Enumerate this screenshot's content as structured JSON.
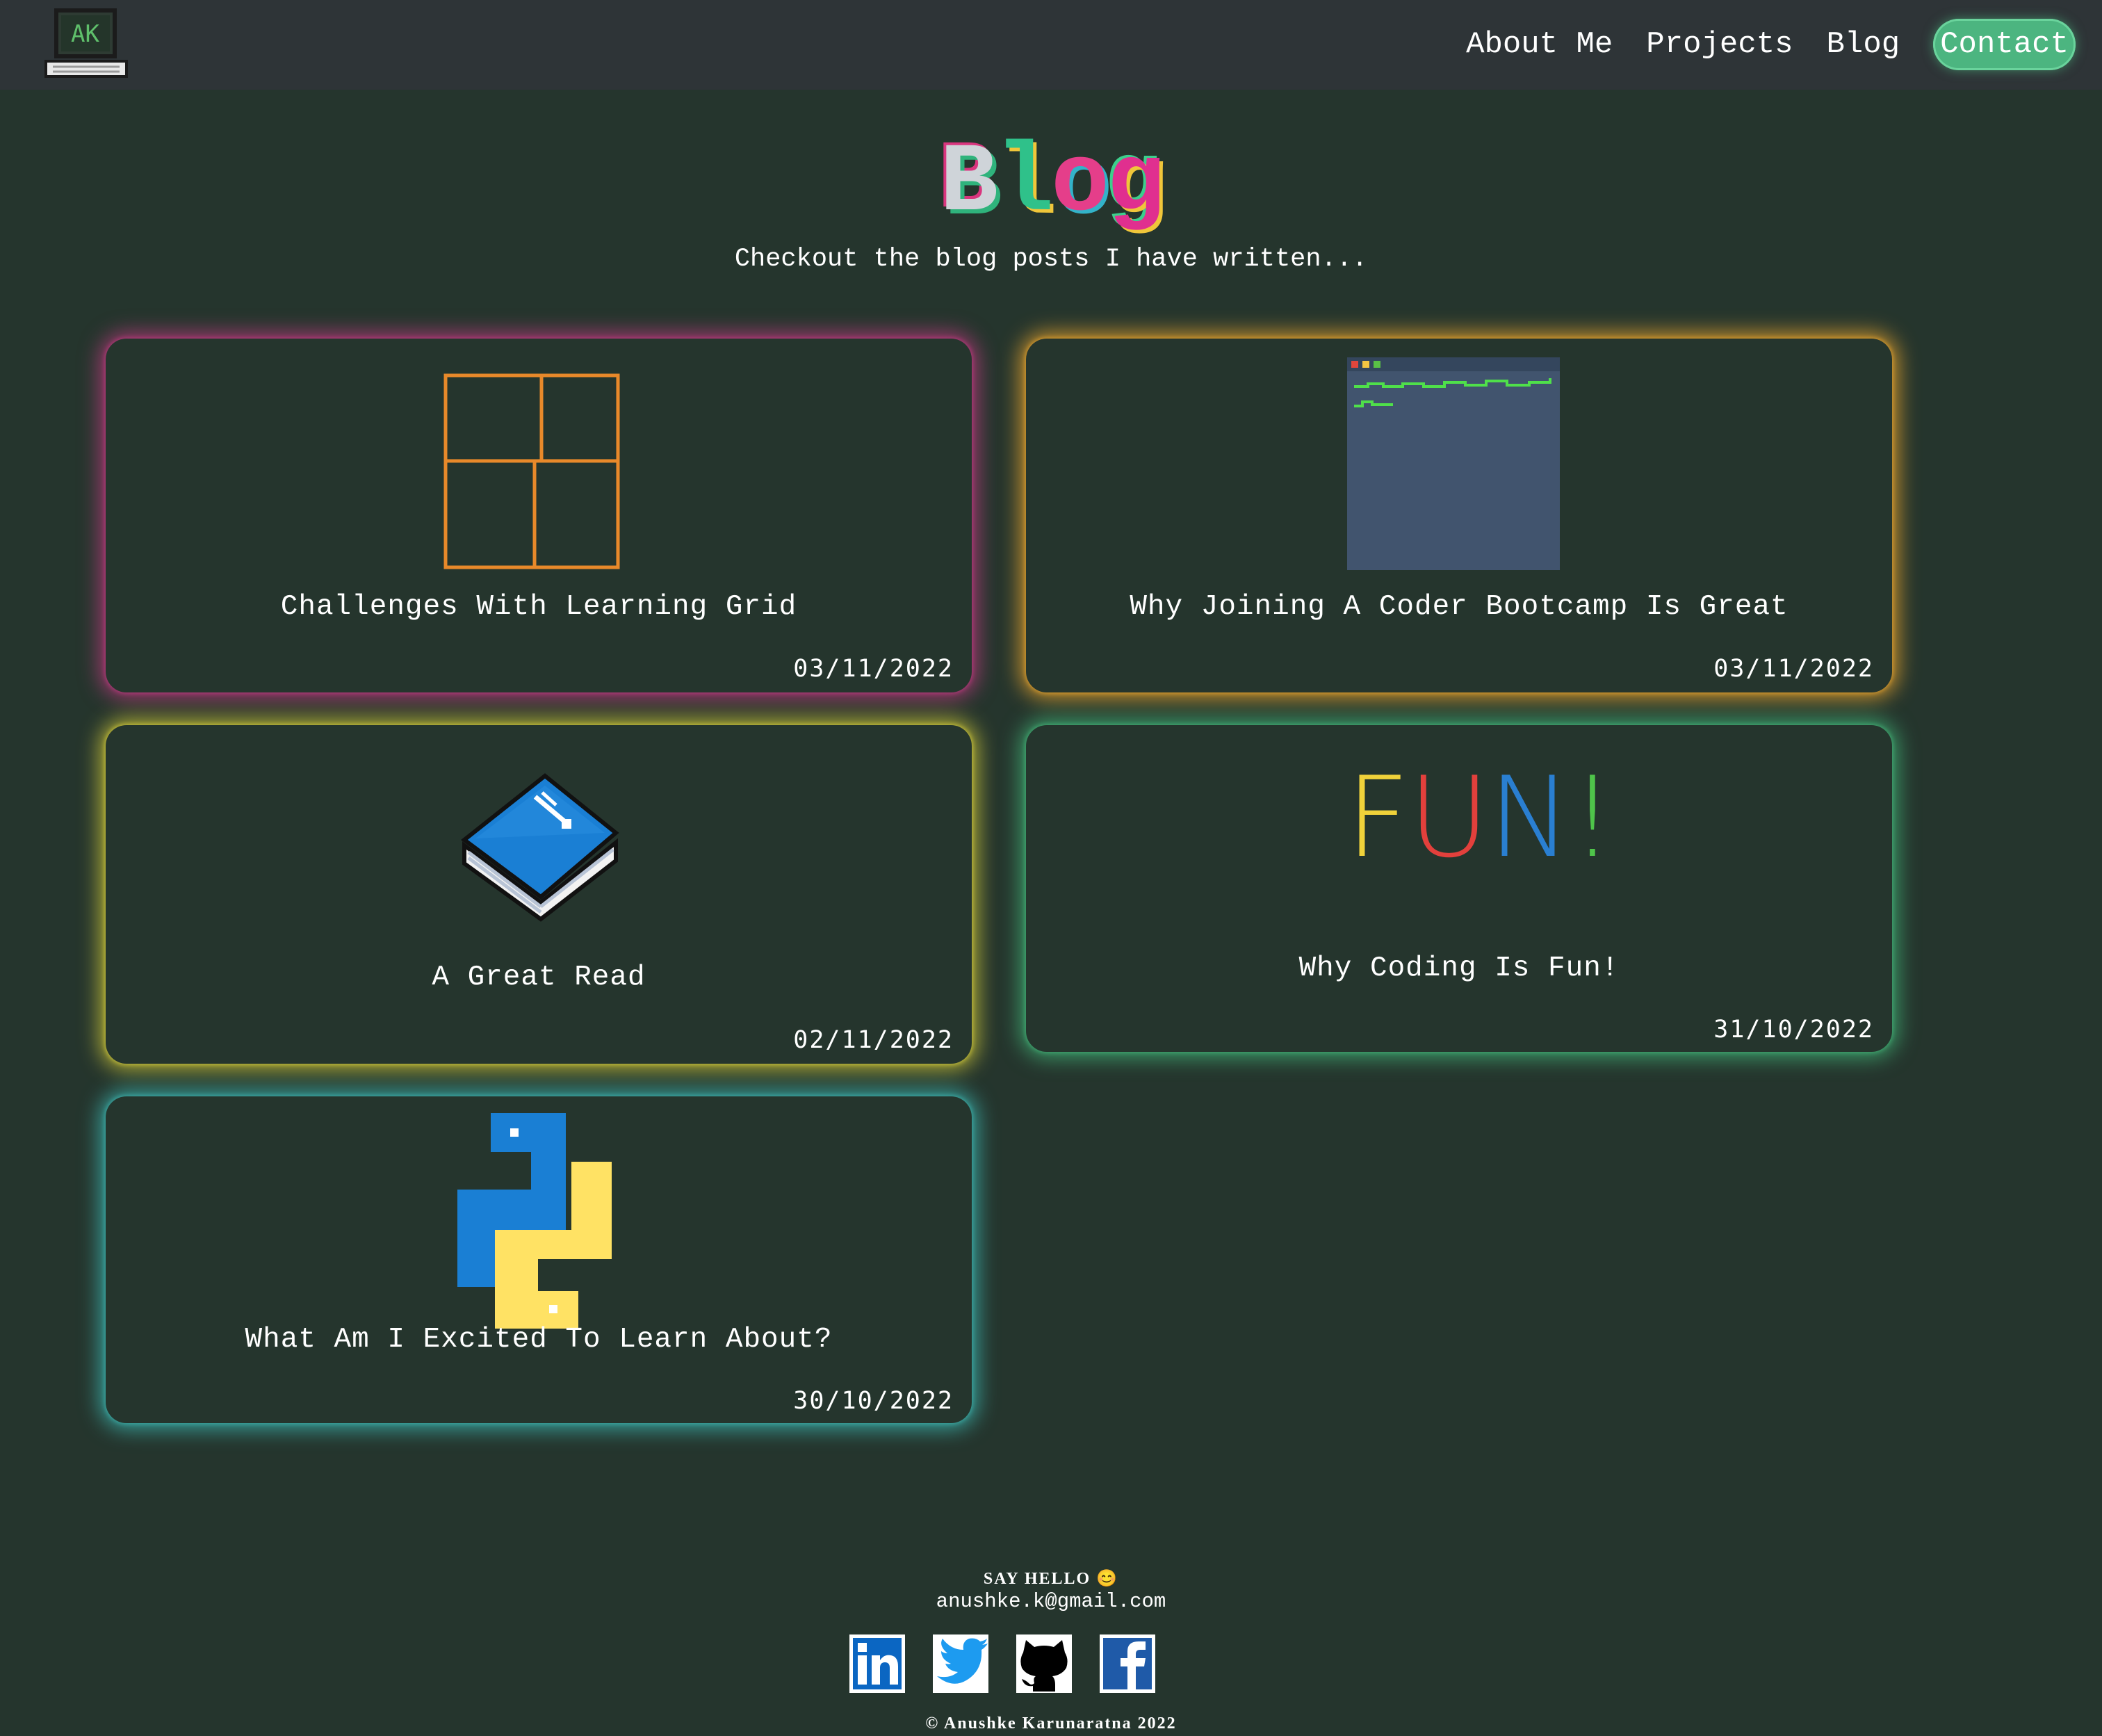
{
  "nav": {
    "logo_icon": "ak-computer-logo",
    "links": [
      {
        "label": "About Me"
      },
      {
        "label": "Projects"
      },
      {
        "label": "Blog"
      },
      {
        "label": "Contact"
      }
    ],
    "contact_color": "#4cb580"
  },
  "header": {
    "title_letters": [
      "B",
      "l",
      "o",
      "g"
    ],
    "subtitle": "Checkout the blog posts I have written..."
  },
  "posts": [
    {
      "title": "Challenges With Learning Grid",
      "date": "03/11/2022",
      "icon": "grid-layout-icon",
      "glow": "#d63a8c"
    },
    {
      "title": "Why Joining A Coder Bootcamp Is Great",
      "date": "03/11/2022",
      "icon": "terminal-window-icon",
      "glow": "#e8a32e"
    },
    {
      "title": "A Great Read",
      "date": "02/11/2022",
      "icon": "book-icon",
      "glow": "#d6cd3a"
    },
    {
      "title": "Why Coding Is Fun!",
      "date": "31/10/2022",
      "icon": "fun-text-icon",
      "glow": "#42b578"
    },
    {
      "title": "What Am I Excited To Learn About?",
      "date": "30/10/2022",
      "icon": "python-logo-icon",
      "glow": "#3cb4af"
    }
  ],
  "fun_letters": [
    "F",
    "U",
    "N",
    "!"
  ],
  "footer": {
    "hello": "SAY HELLO 😊",
    "email": "anushke.k@gmail.com",
    "socials": [
      {
        "icon": "linkedin-icon"
      },
      {
        "icon": "twitter-icon"
      },
      {
        "icon": "github-icon"
      },
      {
        "icon": "facebook-icon"
      }
    ],
    "copyright": "© Anushke Karunaratna 2022"
  }
}
